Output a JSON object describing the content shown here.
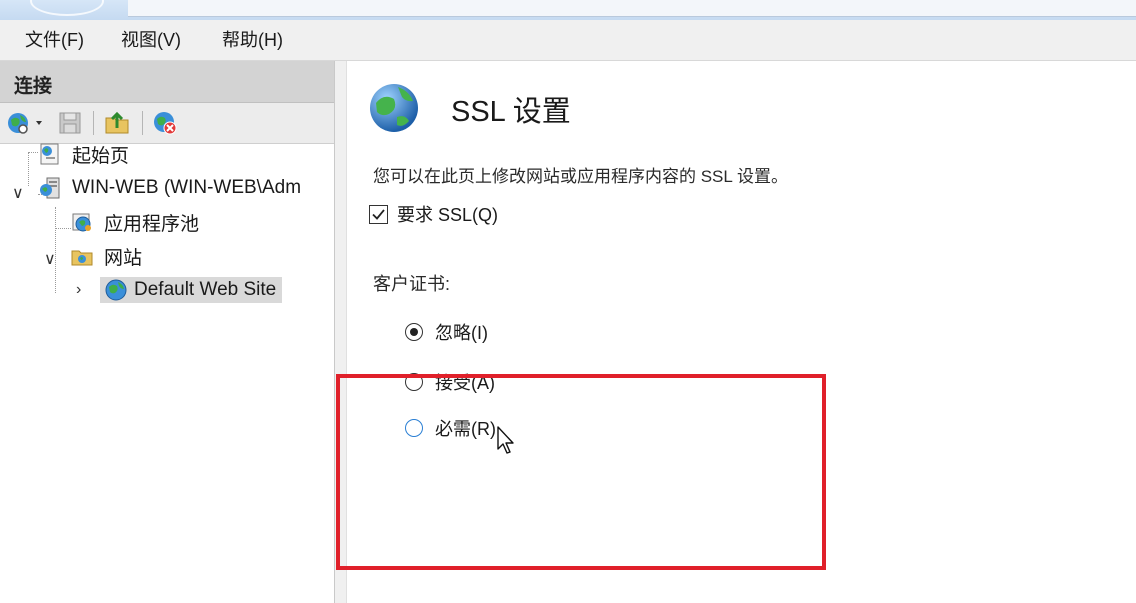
{
  "menu": {
    "file": "文件(F)",
    "view": "视图(V)",
    "help": "帮助(H)"
  },
  "connections": {
    "header": "连接",
    "tree": {
      "start_page": "起始页",
      "server": "WIN-WEB (WIN-WEB\\Adm",
      "app_pools": "应用程序池",
      "sites": "网站",
      "default_site": "Default Web Site"
    }
  },
  "ssl": {
    "title": "SSL 设置",
    "description": "您可以在此页上修改网站或应用程序内容的 SSL 设置。",
    "require_ssl_label": "要求 SSL(Q)",
    "require_ssl_checked": true,
    "client_cert_label": "客户证书:",
    "options": {
      "ignore": "忽略(I)",
      "accept": "接受(A)",
      "require": "必需(R)"
    },
    "selected_option": "ignore"
  },
  "colors": {
    "highlight_box": "#e0202a",
    "selected_tree_item": "#d9d9d9"
  }
}
